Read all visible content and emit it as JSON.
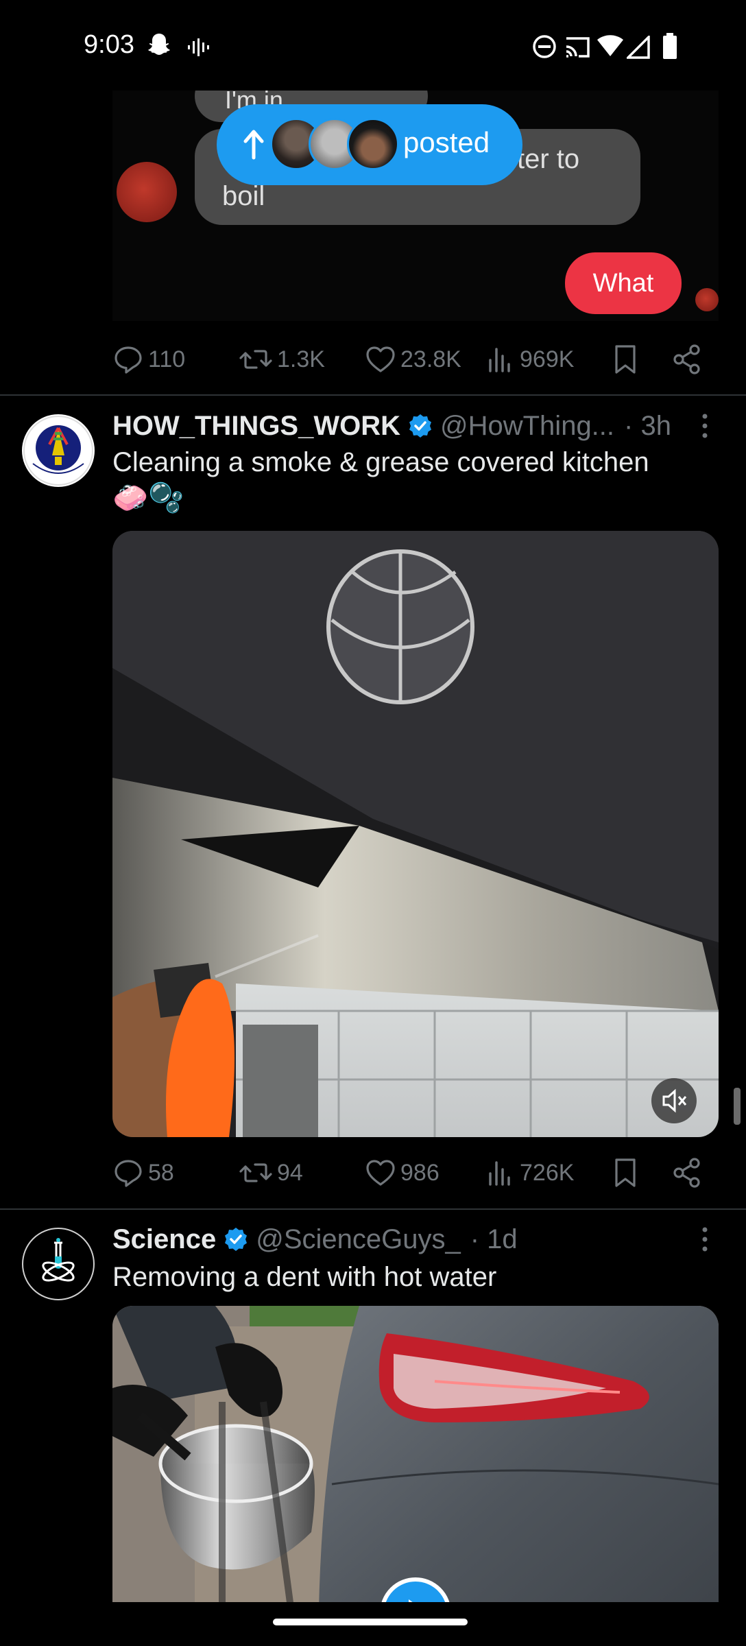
{
  "status_bar": {
    "time": "9:03",
    "icons": [
      "snapchat-icon",
      "voice-icon",
      "do-not-disturb-icon",
      "cast-icon",
      "wifi-icon",
      "signal-icon",
      "battery-icon"
    ]
  },
  "prev_tweet": {
    "chat_text_top": "I'm in",
    "chat_text_1": "ter to",
    "chat_text_2": "boil",
    "chat_reply": "What",
    "actions": {
      "replies": "110",
      "reposts": "1.3K",
      "likes": "23.8K",
      "views": "969K"
    }
  },
  "posted_pill": {
    "label": "posted"
  },
  "tweets": [
    {
      "display_name": "HOW_THINGS_WORK",
      "handle": "@HowThing...",
      "time": "· 3h",
      "text": "Cleaning a smoke & grease covered kitchen",
      "emoji": "🧼🫧",
      "avatar_text": "How things work",
      "actions": {
        "replies": "58",
        "reposts": "94",
        "likes": "986",
        "views": "726K"
      }
    },
    {
      "display_name": "Science",
      "handle": "@ScienceGuys_",
      "time": "· 1d",
      "text": "Removing a dent with hot water"
    }
  ],
  "colors": {
    "accent": "#1d9bf0",
    "muted": "#71767b",
    "text": "#e7e9ea",
    "divider": "#2f3336",
    "background": "#000000"
  }
}
